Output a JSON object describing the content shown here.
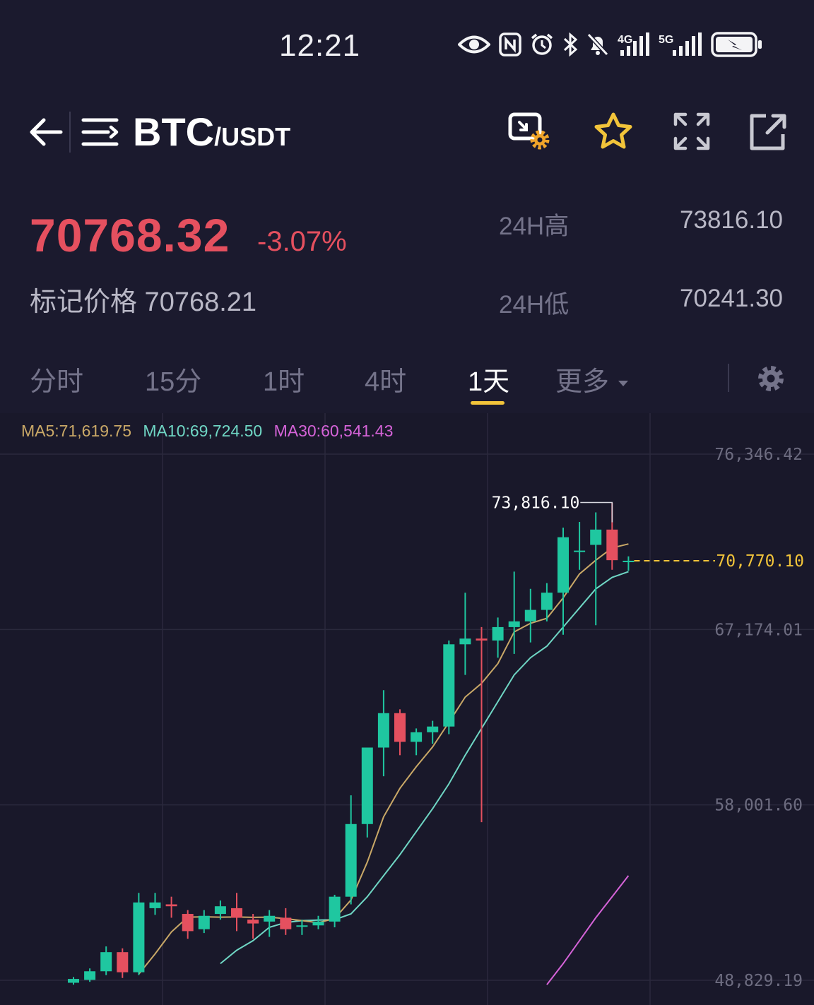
{
  "status_bar": {
    "time": "12:21",
    "icons": [
      "eye-icon",
      "nfc-icon",
      "alarm-icon",
      "bluetooth-icon",
      "mute-icon",
      "signal-4g-icon",
      "signal-5g-icon",
      "battery-charging-icon"
    ],
    "network_4g": "4G",
    "network_5g": "5G"
  },
  "header": {
    "base": "BTC",
    "quote": "/USDT",
    "icons": [
      "back-arrow-icon",
      "menu-icon",
      "display-settings-icon",
      "star-icon",
      "expand-icon",
      "share-icon"
    ]
  },
  "price": {
    "last": "70768.32",
    "change": "-3.07%",
    "mark_label": "标记价格 70768.21",
    "high_label": "24H高",
    "high_value": "73816.10",
    "low_label": "24H低",
    "low_value": "70241.30"
  },
  "tabs": {
    "items": [
      "分时",
      "15分",
      "1时",
      "4时",
      "1天",
      "更多"
    ],
    "active": "1天"
  },
  "colors": {
    "up": "#1fc7a0",
    "down": "#e5505f",
    "ma5": "#c9a867",
    "ma10": "#6fd6c4",
    "ma30": "#d563d8",
    "accent": "#f2c43a"
  },
  "chart_data": {
    "type": "candlestick",
    "ma_legend": {
      "ma5": "MA5:71,619.75",
      "ma10": "MA10:69,724.50",
      "ma30": "MA30:60,541.43"
    },
    "y_tick_labels": [
      "76,346.42",
      "67,174.01",
      "58,001.60",
      "48,829.19"
    ],
    "y_ticks": [
      76346.42,
      67174.01,
      58001.6,
      48829.19
    ],
    "high_annotation": "73,816.10",
    "high_value": 73816.1,
    "current_price_label": "70,770.10",
    "current_price": 70770.1,
    "candles": [
      [
        48700,
        48900,
        48600,
        49000
      ],
      [
        48850,
        49300,
        48750,
        49450
      ],
      [
        49300,
        50300,
        49100,
        50600
      ],
      [
        50300,
        49250,
        48950,
        50500
      ],
      [
        49250,
        52900,
        49100,
        53400
      ],
      [
        52600,
        52900,
        52250,
        53400
      ],
      [
        52800,
        52700,
        52100,
        53200
      ],
      [
        52300,
        51400,
        51000,
        52500
      ],
      [
        51500,
        52200,
        51300,
        52500
      ],
      [
        52300,
        52700,
        52000,
        53000
      ],
      [
        52600,
        52100,
        51400,
        53400
      ],
      [
        52000,
        51800,
        51000,
        52300
      ],
      [
        51900,
        52200,
        51100,
        52500
      ],
      [
        52100,
        51500,
        51200,
        52600
      ],
      [
        51700,
        51700,
        51200,
        52000
      ],
      [
        51700,
        51900,
        51500,
        52200
      ],
      [
        51900,
        53200,
        51600,
        53300
      ],
      [
        53200,
        57000,
        52800,
        58500
      ],
      [
        57000,
        61000,
        56300,
        61000
      ],
      [
        61000,
        62800,
        59500,
        64000
      ],
      [
        62800,
        61300,
        60600,
        63000
      ],
      [
        61300,
        61800,
        60600,
        62000
      ],
      [
        61800,
        62100,
        61200,
        62400
      ],
      [
        62100,
        66400,
        61700,
        66600
      ],
      [
        66400,
        66700,
        64800,
        69100
      ],
      [
        66700,
        66600,
        57100,
        67300
      ],
      [
        66600,
        67300,
        65700,
        67800
      ],
      [
        67300,
        67600,
        65900,
        70200
      ],
      [
        67600,
        68200,
        66500,
        69300
      ],
      [
        68200,
        69100,
        67600,
        69600
      ],
      [
        69100,
        72000,
        66900,
        72500
      ],
      [
        71300,
        71300,
        70300,
        72800
      ],
      [
        71600,
        72400,
        67400,
        73300
      ],
      [
        72400,
        70800,
        70300,
        73800
      ],
      [
        70770,
        70770,
        70240,
        71000
      ]
    ],
    "ma5": [
      null,
      null,
      null,
      null,
      49150,
      50210,
      51360,
      52130,
      52150,
      52130,
      52140,
      52120,
      52130,
      52050,
      51950,
      51840,
      52060,
      53030,
      55010,
      57380,
      58870,
      60000,
      61030,
      62320,
      63640,
      64360,
      65390,
      67050,
      67500,
      67760,
      68830,
      70080,
      70800,
      71440,
      71650
    ],
    "ma10": [
      null,
      null,
      null,
      null,
      null,
      null,
      null,
      null,
      null,
      49700,
      50400,
      50900,
      51600,
      51850,
      51950,
      51980,
      52000,
      52300,
      53200,
      54300,
      55400,
      56600,
      57800,
      59100,
      60600,
      62000,
      63400,
      64800,
      65700,
      66300,
      67300,
      68300,
      69300,
      69900,
      70200
    ],
    "ma30": [
      null,
      null,
      null,
      null,
      null,
      null,
      null,
      null,
      null,
      null,
      null,
      null,
      null,
      null,
      null,
      null,
      null,
      null,
      null,
      null,
      null,
      null,
      null,
      null,
      null,
      null,
      null,
      null,
      null,
      48600,
      49700,
      50900,
      52100,
      53200,
      54300
    ]
  }
}
